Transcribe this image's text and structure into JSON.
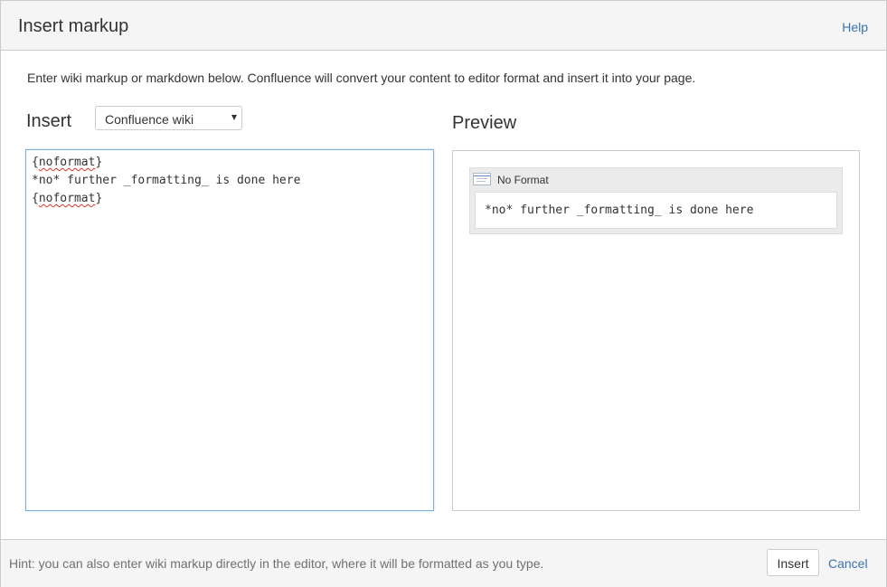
{
  "dialog": {
    "title": "Insert markup",
    "help_label": "Help"
  },
  "intro_text": "Enter wiki markup or markdown below. Confluence will convert your content to editor format and insert it into your page.",
  "insert_section": {
    "heading": "Insert",
    "format_select": {
      "selected": "Confluence wiki"
    }
  },
  "editor": {
    "lines": [
      {
        "before": "{",
        "word": "noformat",
        "after": "}"
      },
      {
        "text": "*no* further _formatting_ is done here"
      },
      {
        "before": "{",
        "word": "noformat",
        "after": "}"
      }
    ]
  },
  "preview": {
    "heading": "Preview",
    "macro": {
      "label": "No Format",
      "icon": "noformat-macro-icon",
      "body": "*no* further _formatting_ is done here"
    }
  },
  "footer": {
    "hint": "Hint: you can also enter wiki markup directly in the editor, where it will be formatted as you type.",
    "insert_label": "Insert",
    "cancel_label": "Cancel"
  },
  "colors": {
    "link": "#3b73af",
    "focus_border": "#7eb0e0",
    "spellcheck": "#e03030"
  }
}
